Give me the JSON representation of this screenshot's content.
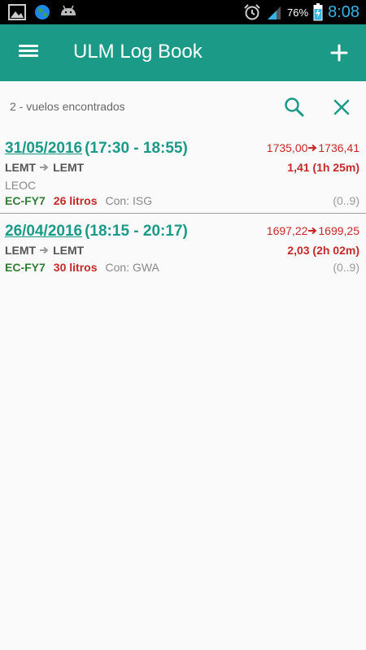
{
  "status_bar": {
    "icons_left": [
      "gallery-icon",
      "globe-icon",
      "android-icon"
    ],
    "battery_pct": "76%",
    "time": "8:08"
  },
  "app_bar": {
    "title": "ULM Log Book",
    "background": "#1b9a87"
  },
  "results": {
    "count_text": "2 - vuelos encontrados"
  },
  "flights": [
    {
      "date": "31/05/2016",
      "time_range": "(17:30 - 18:55)",
      "meter": "1735,00➔1736,41",
      "meter_start": "1735,00",
      "meter_end": "1736,41",
      "from": "LEMT",
      "to": "LEMT",
      "duration": "1,41 (1h 25m)",
      "extra": "LEOC",
      "registration": "EC-FY7",
      "fuel": "26 litros",
      "crew": "Con: ISG",
      "index": "(0..9)"
    },
    {
      "date": "26/04/2016",
      "time_range": "(18:15 - 20:17)",
      "meter_start": "1697,22",
      "meter_end": "1699,25",
      "from": "LEMT",
      "to": "LEMT",
      "duration": "2,03 (2h 02m)",
      "extra": "",
      "registration": "EC-FY7",
      "fuel": "30 litros",
      "crew": "Con: GWA",
      "index": "(0..9)"
    }
  ]
}
